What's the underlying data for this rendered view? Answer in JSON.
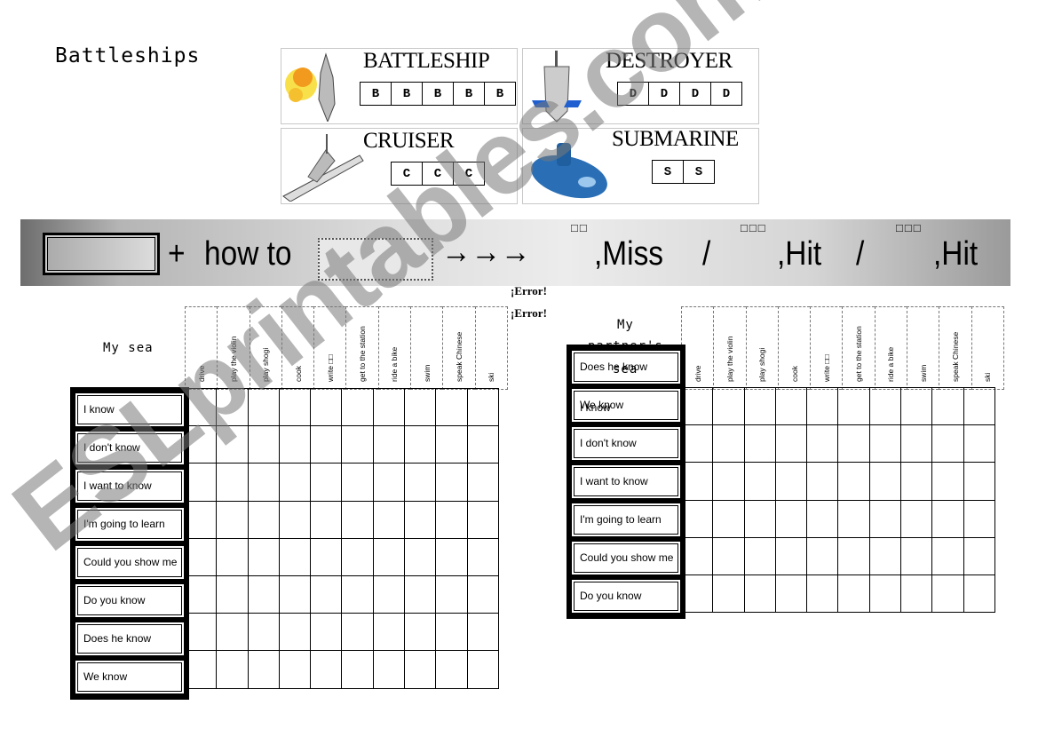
{
  "title": "Battleships",
  "ships": [
    {
      "name": "BATTLESHIP",
      "cells": [
        "B",
        "B",
        "B",
        "B",
        "B"
      ]
    },
    {
      "name": "DESTROYER",
      "cells": [
        "D",
        "D",
        "D",
        "D"
      ]
    },
    {
      "name": "CRUISER",
      "cells": [
        "C",
        "C",
        "C"
      ]
    },
    {
      "name": "SUBMARINE",
      "cells": [
        "S",
        "S"
      ]
    }
  ],
  "banner": {
    "plus": "+",
    "how_to": "how to",
    "arrows": "→→→",
    "miss": ",Miss",
    "slash1": "/",
    "hit1": ",Hit",
    "slash2": "/",
    "hit2": ",Hit",
    "glyph_miss": "□□",
    "glyph_hit1": "□□□",
    "glyph_hit2": "□□□"
  },
  "errors": [
    "¡Error!",
    "¡Error!"
  ],
  "columns": [
    "drive",
    "play the violin",
    "play shogi",
    "cook",
    "write □□",
    "get to the station",
    "ride a bike",
    "swim",
    "speak Chinese",
    "ski"
  ],
  "my_sea": {
    "label": "My sea",
    "rows": [
      "I know",
      "I don't know",
      "I want to know",
      "I'm going to learn",
      "Could you show me",
      "Do you know",
      "Does he know",
      "We know"
    ]
  },
  "partner_sea": {
    "label_line1": "My",
    "label_line2": "partner's",
    "label_line3": "sea",
    "rows": [
      "Does he know",
      "We know",
      "I don't know",
      "I want to know",
      "I'm going to learn",
      "Could you show me",
      "Do you know"
    ],
    "overlap_text": "I know"
  },
  "watermark": "ESLprintables.com",
  "colors": {
    "banner_gray": "#c8c8c8",
    "sub_blue": "#2a6fb5"
  }
}
